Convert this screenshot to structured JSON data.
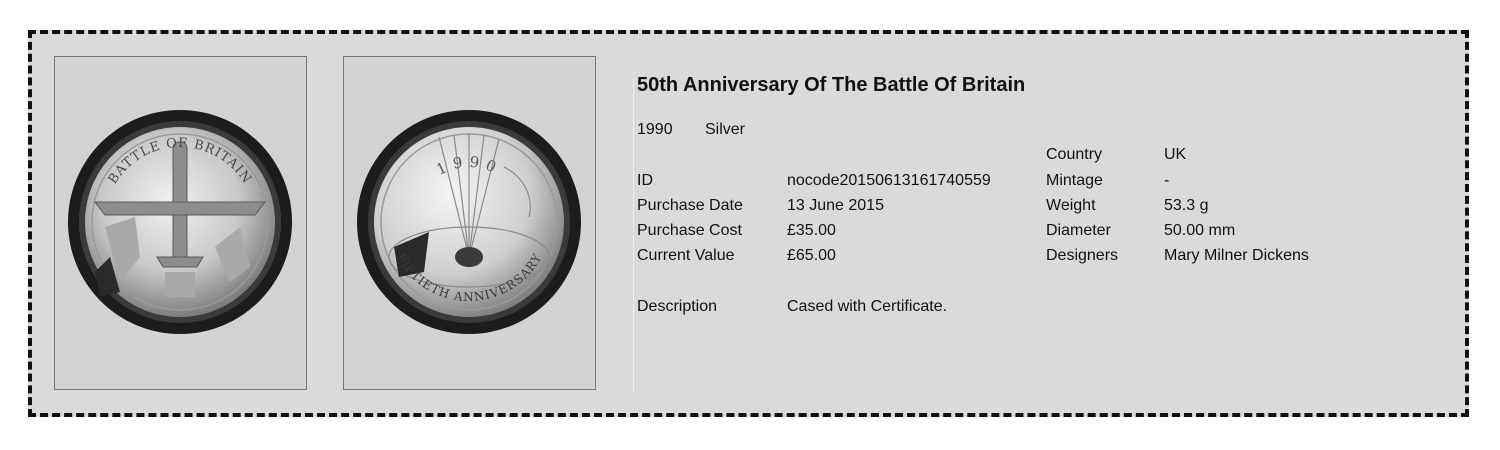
{
  "coin": {
    "title": "50th Anniversary Of The Battle Of Britain",
    "year": "1990",
    "metal": "Silver",
    "obverse_text": "BATTLE OF BRITAIN",
    "reverse_year": "1990",
    "reverse_text": "FIFTIETH ANNIVERSARY"
  },
  "details_left": [
    {
      "label": "ID",
      "value": "nocode20150613161740559"
    },
    {
      "label": "Purchase Date",
      "value": "13 June 2015"
    },
    {
      "label": "Purchase Cost",
      "value": "£35.00"
    },
    {
      "label": "Current Value",
      "value": "£65.00"
    }
  ],
  "description": {
    "label": "Description",
    "value": "Cased with Certificate."
  },
  "details_right": [
    {
      "label": "Country",
      "value": "UK"
    },
    {
      "label": "Mintage",
      "value": "-"
    },
    {
      "label": "Weight",
      "value": "53.3 g"
    },
    {
      "label": "Diameter",
      "value": "50.00 mm"
    },
    {
      "label": "Designers",
      "value": "Mary Milner Dickens"
    }
  ],
  "colors": {
    "card_background": "#dadada",
    "border": "#111111",
    "coin_capsule": "#1c1c1c",
    "coin_silver": "#c8c8c8"
  }
}
